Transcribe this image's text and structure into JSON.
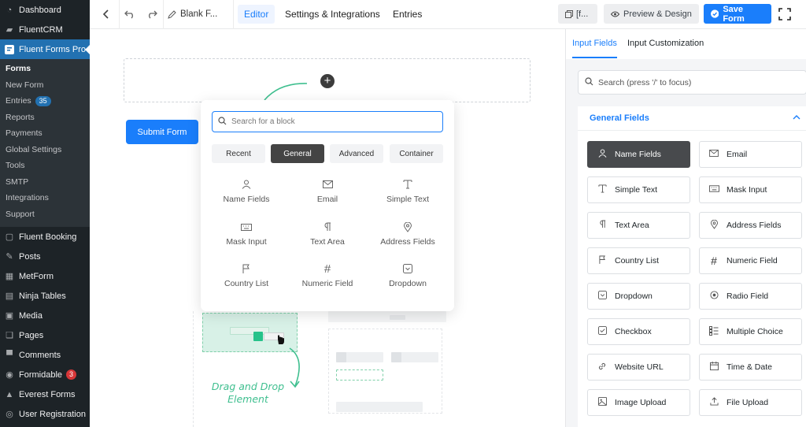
{
  "wp_menu": {
    "items_top": [
      {
        "label": "Dashboard",
        "icon": "dashboard-icon"
      },
      {
        "label": "FluentCRM",
        "icon": "fluentcrm-icon"
      },
      {
        "label": "Fluent Forms Pro",
        "icon": "fluent-forms-icon"
      }
    ],
    "submenu": [
      {
        "label": "Forms"
      },
      {
        "label": "New Form"
      },
      {
        "label": "Entries",
        "badge": "35"
      },
      {
        "label": "Reports"
      },
      {
        "label": "Payments"
      },
      {
        "label": "Global Settings"
      },
      {
        "label": "Tools"
      },
      {
        "label": "SMTP"
      },
      {
        "label": "Integrations"
      },
      {
        "label": "Support"
      }
    ],
    "items_bottom": [
      {
        "label": "Fluent Booking",
        "icon": "fluent-booking-icon"
      },
      {
        "label": "Posts",
        "icon": "pin-icon"
      },
      {
        "label": "MetForm",
        "icon": "metform-icon"
      },
      {
        "label": "Ninja Tables",
        "icon": "table-icon"
      },
      {
        "label": "Media",
        "icon": "media-icon"
      },
      {
        "label": "Pages",
        "icon": "pages-icon"
      },
      {
        "label": "Comments",
        "icon": "comment-icon"
      },
      {
        "label": "Formidable",
        "icon": "formidable-icon",
        "badge": "3"
      },
      {
        "label": "Everest Forms",
        "icon": "everest-forms-icon"
      },
      {
        "label": "User Registration",
        "icon": "user-registration-icon"
      }
    ]
  },
  "toolbar": {
    "form_title": "Blank F...",
    "tabs": [
      "Editor",
      "Settings & Integrations",
      "Entries"
    ],
    "shortcode_label": "[f...",
    "preview_label": "Preview & Design",
    "save_label": "Save Form"
  },
  "canvas": {
    "submit_label": "Submit Form",
    "plus_symbol": "+"
  },
  "popover": {
    "search_placeholder": "Search for a block",
    "tabs": [
      "Recent",
      "General",
      "Advanced",
      "Container"
    ],
    "blocks": [
      {
        "label": "Name Fields",
        "icon": "person-icon"
      },
      {
        "label": "Email",
        "icon": "envelope-icon"
      },
      {
        "label": "Simple Text",
        "icon": "text-cursor-icon"
      },
      {
        "label": "Mask Input",
        "icon": "keyboard-icon"
      },
      {
        "label": "Text Area",
        "icon": "paragraph-icon"
      },
      {
        "label": "Address Fields",
        "icon": "map-pin-icon"
      },
      {
        "label": "Country List",
        "icon": "flag-icon"
      },
      {
        "label": "Numeric Field",
        "icon": "hash-icon"
      },
      {
        "label": "Dropdown",
        "icon": "dropdown-icon"
      }
    ]
  },
  "illustration": {
    "line1": "Drag and Drop",
    "line2": "Element"
  },
  "right_panel": {
    "tabs": [
      "Input Fields",
      "Input Customization"
    ],
    "search_placeholder": "Search (press '/' to focus)",
    "section_title": "General Fields",
    "fields": [
      {
        "label": "Name Fields",
        "icon": "person-icon"
      },
      {
        "label": "Email",
        "icon": "envelope-icon"
      },
      {
        "label": "Simple Text",
        "icon": "text-cursor-icon"
      },
      {
        "label": "Mask Input",
        "icon": "keyboard-icon"
      },
      {
        "label": "Text Area",
        "icon": "paragraph-icon"
      },
      {
        "label": "Address Fields",
        "icon": "map-pin-icon"
      },
      {
        "label": "Country List",
        "icon": "flag-icon"
      },
      {
        "label": "Numeric Field",
        "icon": "hash-icon"
      },
      {
        "label": "Dropdown",
        "icon": "dropdown-icon"
      },
      {
        "label": "Radio Field",
        "icon": "radio-icon"
      },
      {
        "label": "Checkbox",
        "icon": "checkbox-icon"
      },
      {
        "label": "Multiple Choice",
        "icon": "list-icon"
      },
      {
        "label": "Website URL",
        "icon": "link-icon"
      },
      {
        "label": "Time & Date",
        "icon": "calendar-icon"
      },
      {
        "label": "Image Upload",
        "icon": "image-icon"
      },
      {
        "label": "File Upload",
        "icon": "upload-icon"
      }
    ]
  },
  "colors": {
    "brand_blue": "#1a7efb",
    "wp_sidebar": "#1d2327",
    "wp_active": "#2271b1",
    "accent_green": "#3fbf8f"
  }
}
